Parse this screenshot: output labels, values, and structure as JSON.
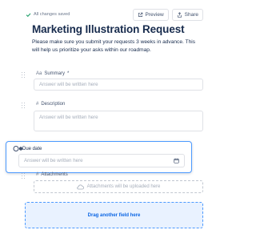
{
  "header": {
    "saved_status": "All changes saved",
    "preview_label": "Preview",
    "share_label": "Share"
  },
  "form": {
    "title": "Marketing Illustration Request",
    "description": "Please make sure you submit your requests 3 weeks in advance. This will help us prioritize your asks within our roadmap."
  },
  "fields": {
    "summary": {
      "label": "Summary",
      "required_mark": "*",
      "placeholder": "Answer will be written here",
      "icon": "text-icon"
    },
    "description": {
      "label": "Description",
      "placeholder": "Answer will be written here",
      "icon": "hash-icon"
    },
    "due_date": {
      "label": "Due date",
      "placeholder": "Answer will be written here",
      "icon": "calendar-icon"
    },
    "attachments": {
      "label": "Attachments",
      "placeholder": "Attachments will be uploaded here",
      "icon": "paperclip-icon"
    }
  },
  "dropzone": {
    "label": "Drag another field here"
  },
  "colors": {
    "accent": "#0c66e4",
    "focus_border": "#4c9aff",
    "dropzone_bg": "#e9f2ff",
    "success": "#22a06b"
  }
}
